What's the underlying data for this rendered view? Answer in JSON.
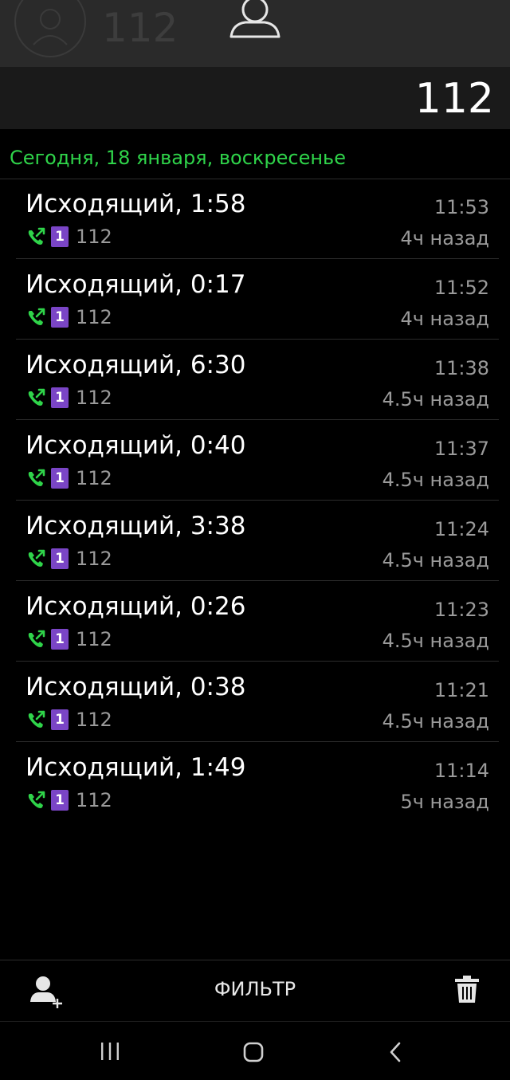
{
  "topbar": {
    "faded_number": "112",
    "avatar_icon": "person-icon"
  },
  "header": {
    "number": "112"
  },
  "date_header": "Сегодня, 18 января, воскресенье",
  "calls": [
    {
      "title": "Исходящий, 1:58",
      "time": "11:53",
      "sim": "1",
      "number": "112",
      "ago": "4ч назад"
    },
    {
      "title": "Исходящий, 0:17",
      "time": "11:52",
      "sim": "1",
      "number": "112",
      "ago": "4ч назад"
    },
    {
      "title": "Исходящий, 6:30",
      "time": "11:38",
      "sim": "1",
      "number": "112",
      "ago": "4.5ч назад"
    },
    {
      "title": "Исходящий, 0:40",
      "time": "11:37",
      "sim": "1",
      "number": "112",
      "ago": "4.5ч назад"
    },
    {
      "title": "Исходящий, 3:38",
      "time": "11:24",
      "sim": "1",
      "number": "112",
      "ago": "4.5ч назад"
    },
    {
      "title": "Исходящий, 0:26",
      "time": "11:23",
      "sim": "1",
      "number": "112",
      "ago": "4.5ч назад"
    },
    {
      "title": "Исходящий, 0:38",
      "time": "11:21",
      "sim": "1",
      "number": "112",
      "ago": "4.5ч назад"
    },
    {
      "title": "Исходящий, 1:49",
      "time": "11:14",
      "sim": "1",
      "number": "112",
      "ago": "5ч назад"
    }
  ],
  "bottom_bar": {
    "filter_label": "ФИЛЬТР",
    "add_contact_icon": "add-contact-icon",
    "delete_icon": "trash-icon"
  },
  "colors": {
    "accent_green": "#2fd44a",
    "sim_purple": "#7a45c6",
    "secondary_text": "#9a9a9a"
  }
}
